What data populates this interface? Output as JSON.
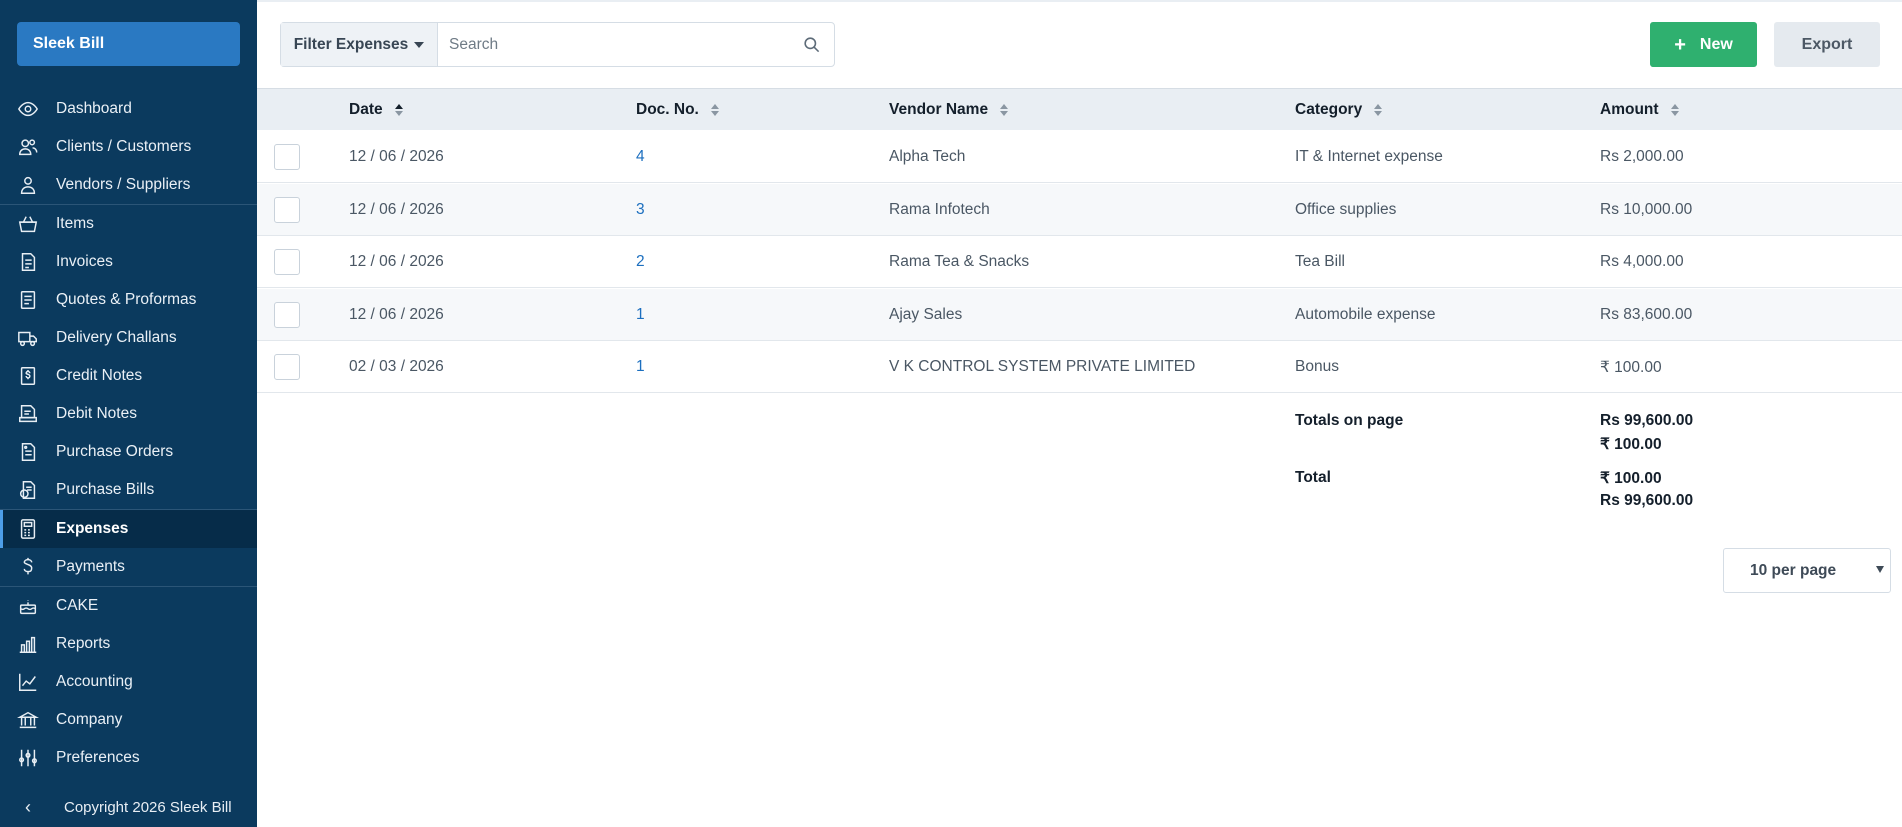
{
  "app": {
    "brand": "Sleek Bill"
  },
  "sidebar": {
    "items": [
      {
        "label": "Dashboard",
        "icon": "eye-icon"
      },
      {
        "label": "Clients / Customers",
        "icon": "users-icon"
      },
      {
        "label": "Vendors / Suppliers",
        "icon": "user-icon"
      },
      {
        "label": "Items",
        "icon": "basket-icon"
      },
      {
        "label": "Invoices",
        "icon": "invoice-icon"
      },
      {
        "label": "Quotes & Proformas",
        "icon": "document-icon"
      },
      {
        "label": "Delivery Challans",
        "icon": "truck-icon"
      },
      {
        "label": "Credit Notes",
        "icon": "dollar-document-icon"
      },
      {
        "label": "Debit Notes",
        "icon": "debit-document-icon"
      },
      {
        "label": "Purchase Orders",
        "icon": "purchase-order-icon"
      },
      {
        "label": "Purchase Bills",
        "icon": "bill-icon"
      },
      {
        "label": "Expenses",
        "icon": "calculator-icon"
      },
      {
        "label": "Payments",
        "icon": "dollar-icon"
      },
      {
        "label": "CAKE",
        "icon": "cake-icon"
      },
      {
        "label": "Reports",
        "icon": "bar-chart-icon"
      },
      {
        "label": "Accounting",
        "icon": "chart-line-icon"
      },
      {
        "label": "Company",
        "icon": "bank-icon"
      },
      {
        "label": "Preferences",
        "icon": "sliders-icon"
      }
    ],
    "active": "Expenses",
    "footer": "Copyright 2026 Sleek Bill"
  },
  "toolbar": {
    "filter_label": "Filter Expenses",
    "search_placeholder": "Search",
    "new_label": "New",
    "export_label": "Export"
  },
  "table": {
    "columns": [
      "Date",
      "Doc. No.",
      "Vendor Name",
      "Category",
      "Amount"
    ],
    "rows": [
      {
        "date": "12 / 06 / 2026",
        "doc": "4",
        "vendor": "Alpha Tech",
        "category": "IT & Internet expense",
        "amount": "Rs 2,000.00"
      },
      {
        "date": "12 / 06 / 2026",
        "doc": "3",
        "vendor": "Rama Infotech",
        "category": "Office supplies",
        "amount": "Rs 10,000.00"
      },
      {
        "date": "12 / 06 / 2026",
        "doc": "2",
        "vendor": "Rama Tea & Snacks",
        "category": "Tea Bill",
        "amount": "Rs 4,000.00"
      },
      {
        "date": "12 / 06 / 2026",
        "doc": "1",
        "vendor": "Ajay Sales",
        "category": "Automobile expense",
        "amount": "Rs 83,600.00"
      },
      {
        "date": "02 / 03 / 2026",
        "doc": "1",
        "vendor": "V K CONTROL SYSTEM PRIVATE LIMITED",
        "category": "Bonus",
        "amount": "₹ 100.00"
      }
    ]
  },
  "totals": {
    "page_label": "Totals on page",
    "page_values": [
      "Rs 99,600.00",
      "₹ 100.00"
    ],
    "total_label": "Total",
    "total_values": [
      "₹ 100.00",
      "Rs 99,600.00"
    ]
  },
  "pagination": {
    "per_page": "10 per page"
  },
  "colors": {
    "sidebar": "#0b3a5e",
    "brand": "#2a79c2",
    "new_button": "#2fb06f",
    "link": "#1c6fbf"
  }
}
